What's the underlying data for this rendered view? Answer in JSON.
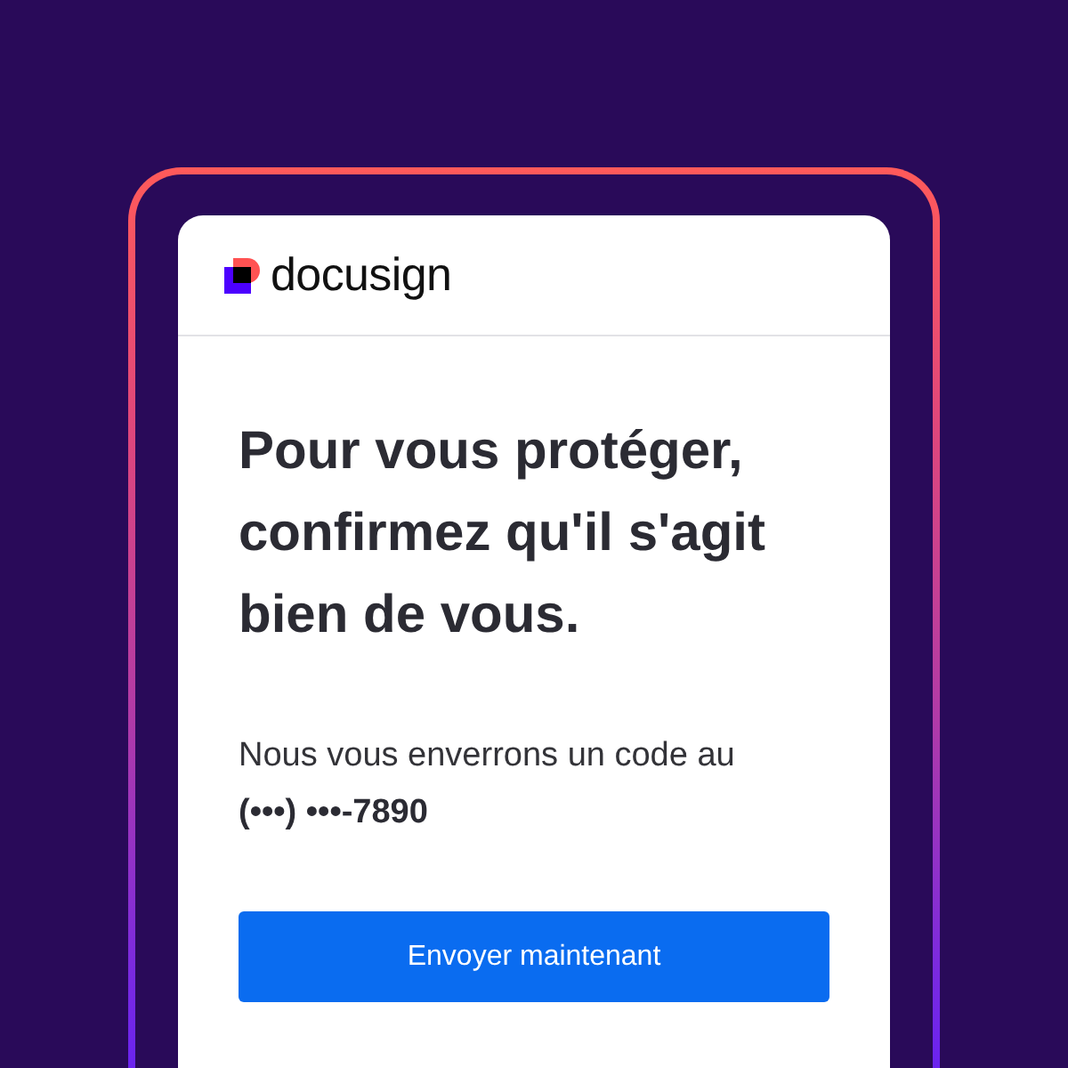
{
  "header": {
    "logo": {
      "text": "docusign"
    }
  },
  "heading": "Pour vous protéger, confirmez qu'il s'agit bien de vous.",
  "message": "Nous vous enverrons un code au",
  "phone": "(•••) •••-7890",
  "button": {
    "label": "Envoyer maintenant"
  }
}
